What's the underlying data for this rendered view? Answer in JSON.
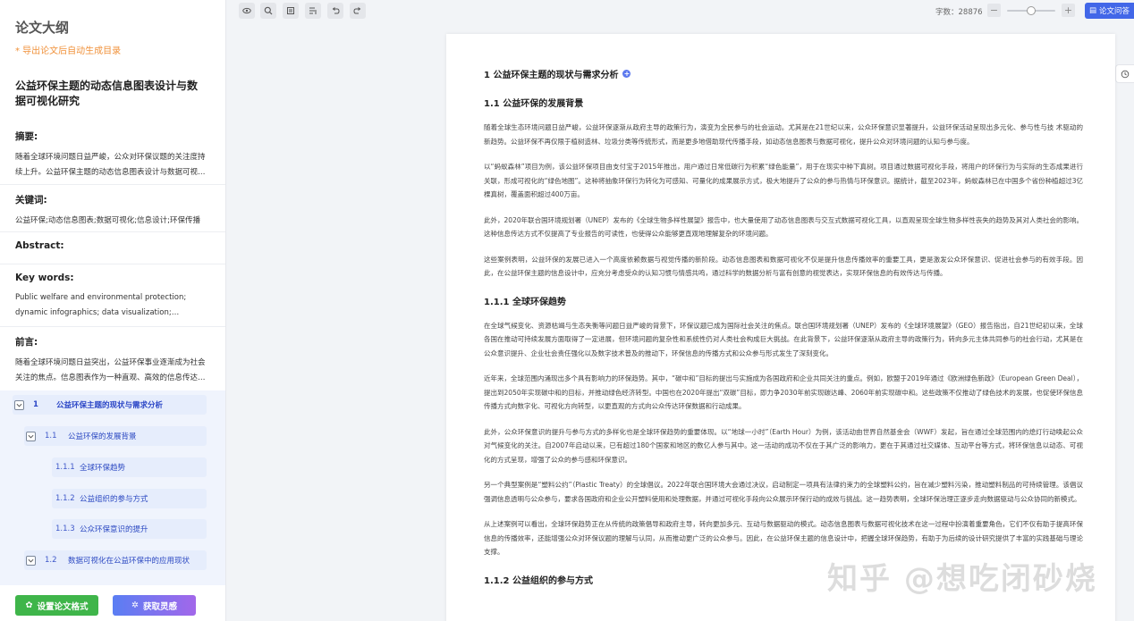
{
  "sidebar": {
    "title": "论文大纲",
    "hint": "* 导出论文后自动生成目录",
    "paper_title": "公益环保主题的动态信息图表设计与数据可视化研究",
    "abstract_label": "摘要:",
    "abstract_text": "随着全球环境问题日益严峻，公众对环保议题的关注度持续上升。公益环保主题的动态信息图表设计与数据可视化研究",
    "keywords_label": "关键词:",
    "keywords_text": "公益环保;动态信息图表;数据可视化;信息设计;环保传播",
    "abstract_en_label": "Abstract:",
    "keywords_en_label": "Key words:",
    "keywords_en_text": "Public welfare and environmental protection; dynamic infographics; data visualization; information design; environmental communication",
    "preface_label": "前言:",
    "preface_text": "随着全球环境问题日益突出，公益环保事业逐渐成为社会关注的焦点。信息图表作为一种直观、高效的信息传达方式…",
    "toc": [
      {
        "num": "1",
        "label": "公益环保主题的现状与需求分析"
      },
      {
        "num": "1.1",
        "label": "公益环保的发展背景"
      },
      {
        "num": "1.1.1",
        "label": "全球环保趋势"
      },
      {
        "num": "1.1.2",
        "label": "公益组织的参与方式"
      },
      {
        "num": "1.1.3",
        "label": "公众环保意识的提升"
      },
      {
        "num": "1.2",
        "label": "数据可视化在公益环保中的应用现状"
      }
    ],
    "btn_format": "设置论文格式",
    "btn_inspire": "获取灵感"
  },
  "toolbar": {
    "word_count": "字数：28876",
    "zoom_minus": "−",
    "zoom_plus": "+",
    "zoom_level": 0.5,
    "qa_label": "论文问答"
  },
  "doc": {
    "h1": "1 公益环保主题的现状与需求分析",
    "h1_1": "1.1 公益环保的发展背景",
    "p1": "随着全球生态环境问题日益严峻，公益环保逐渐从政府主导的政策行为，演变为全民参与的社会运动。尤其是在21世纪以来，公众环保意识显著提升，公益环保活动呈现出多元化、参与性与技 术驱动的新趋势。公益环保不再仅限于植树造林、垃圾分类等传统形式，而是更多地借助现代传播手段，如动态信息图表与数据可视化，提升公众对环境问题的认知与参与度。",
    "p2": "以“蚂蚁森林”项目为例，该公益环保项目由支付宝于2015年推出，用户通过日常低碳行为积累“绿色能量”，用于在现实中种下真树。项目通过数据可视化手段，将用户的环保行为与实际的生态成果进行关联，形成可视化的“绿色地图”。这种将抽象环保行为转化为可感知、可量化的成果展示方式，极大地提升了公众的参与热情与环保意识。据统计，截至2023年，蚂蚁森林已在中国多个省份种植超过3亿棵真树，覆盖面积超过400万亩。",
    "p3": "此外，2020年联合国环境规划署（UNEP）发布的《全球生物多样性展望》报告中，也大量使用了动态信息图表与交互式数据可视化工具，以直观呈现全球生物多样性丧失的趋势及其对人类社会的影响。这种信息传达方式不仅提高了专业报告的可读性，也使得公众能够更直观地理解复杂的环境问题。",
    "p4": "这些案例表明，公益环保的发展已进入一个高度依赖数据与视觉传播的新阶段。动态信息图表和数据可视化不仅是提升信息传播效率的重要工具，更是激发公众环保意识、促进社会参与的有效手段。因此，在公益环保主题的信息设计中，应充分考虑受众的认知习惯与情感共鸣，通过科学的数据分析与富有创意的视觉表达，实现环保信息的有效传达与传播。",
    "h1_1_1": "1.1.1 全球环保趋势",
    "p5": "在全球气候变化、资源枯竭与生态失衡等问题日益严峻的背景下，环保议题已成为国际社会关注的焦点。联合国环境规划署（UNEP）发布的《全球环境展望》（GEO）报告指出，自21世纪初以来，全球各国在推动可持续发展方面取得了一定进展，但环境问题的复杂性和系统性仍对人类社会构成巨大挑战。在此背景下，公益环保逐渐从政府主导的政策行为，转向多元主体共同参与的社会行动，尤其是在公众意识提升、企业社会责任强化以及数字技术普及的推动下，环保信息的传播方式和公众参与形式发生了深刻变化。",
    "p6": "近年来，全球范围内涌现出多个具有影响力的环保趋势。其中，“碳中和”目标的提出与实施成为各国政府和企业共同关注的重点。例如，欧盟于2019年通过《欧洲绿色新政》（European Green Deal），提出到2050年实现碳中和的目标，并推动绿色经济转型。中国也在2020年提出“双碳”目标，即力争2030年前实现碳达峰、2060年前实现碳中和。这些政策不仅推动了绿色技术的发展，也促使环保信息传播方式向数字化、可视化方向转型，以更直观的方式向公众传达环保数据和行动成果。",
    "p7": "此外，公众环保意识的提升与参与方式的多样化也是全球环保趋势的重要体现。以“地球一小时”（Earth Hour）为例，该活动由世界自然基金会（WWF）发起，旨在通过全球范围内的熄灯行动唤起公众对气候变化的关注。自2007年启动以来，已有超过180个国家和地区的数亿人参与其中。这一活动的成功不仅在于其广泛的影响力，更在于其通过社交媒体、互动平台等方式，将环保信息以动态、可视化的方式呈现，增强了公众的参与感和环保意识。",
    "p8": "另一个典型案例是“塑料公约”（Plastic Treaty）的全球倡议。2022年联合国环境大会通过决议，启动制定一项具有法律约束力的全球塑料公约，旨在减少塑料污染，推动塑料制品的可持续管理。该倡议强调信息透明与公众参与，要求各国政府和企业公开塑料使用和处理数据，并通过可视化手段向公众展示环保行动的成效与挑战。这一趋势表明，全球环保治理正逐步走向数据驱动与公众协同的新模式。",
    "p9": "从上述案例可以看出，全球环保趋势正在从传统的政策倡导和政府主导，转向更加多元、互动与数据驱动的模式。动态信息图表与数据可视化技术在这一过程中扮演着重要角色，它们不仅有助于提高环保信息的传播效率，还能增强公众对环保议题的理解与认同，从而推动更广泛的公众参与。因此，在公益环保主题的信息设计中，把握全球环保趋势，有助于为后续的设计研究提供了丰富的实践基础与理论支撑。",
    "h1_1_2": "1.1.2 公益组织的参与方式"
  },
  "watermark": "知乎 @想吃闭砂烧",
  "colors": {
    "accent": "#4267e8",
    "green": "#3fb54a",
    "toc_bg": "#f0f4fd"
  },
  "icons": [
    "eye-icon",
    "search-icon",
    "list-icon",
    "outline-icon",
    "undo-icon",
    "redo-icon",
    "history-icon",
    "gear-icon",
    "sparkle-icon",
    "chevron-down-icon"
  ]
}
